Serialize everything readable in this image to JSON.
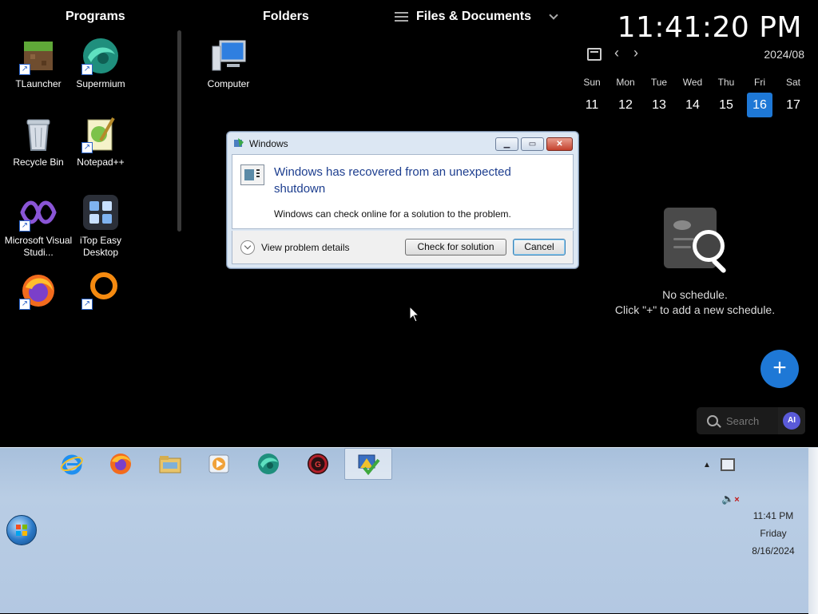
{
  "headers": {
    "programs": "Programs",
    "folders": "Folders",
    "files": "Files & Documents"
  },
  "programs": [
    {
      "label": "TLauncher",
      "icon": "tlauncher-icon"
    },
    {
      "label": "Supermium",
      "icon": "supermium-icon"
    },
    {
      "label": "Recycle Bin",
      "icon": "recycle-bin-icon"
    },
    {
      "label": "Notepad++",
      "icon": "notepad-plus-plus-icon"
    },
    {
      "label": "Microsoft Visual Studi...",
      "icon": "visual-studio-icon"
    },
    {
      "label": "iTop Easy Desktop",
      "icon": "itop-easy-desktop-icon"
    },
    {
      "label": "",
      "icon": "firefox-icon"
    },
    {
      "label": "",
      "icon": "orange-ring-app-icon"
    }
  ],
  "folders": [
    {
      "label": "Computer",
      "icon": "computer-icon"
    }
  ],
  "clock": "11:41:20 PM",
  "calendar": {
    "month": "2024/08",
    "weekdays": [
      "Sun",
      "Mon",
      "Tue",
      "Wed",
      "Thu",
      "Fri",
      "Sat"
    ],
    "days": [
      "11",
      "12",
      "13",
      "14",
      "15",
      "16",
      "17"
    ],
    "today_index": 5,
    "accent_color": "#1e78d6"
  },
  "schedule": {
    "empty_title": "No schedule.",
    "empty_hint": "Click \"+\" to add a new schedule."
  },
  "add_button": "+",
  "search": {
    "placeholder": "Search",
    "ai_label": "AI"
  },
  "dialog": {
    "title": "Windows",
    "heading": "Windows has recovered from an unexpected shutdown",
    "message": "Windows can check online for a solution to the problem.",
    "details_label": "View problem details",
    "check_button": "Check for solution",
    "cancel_button": "Cancel"
  },
  "taskbar": {
    "items": [
      {
        "icon": "internet-explorer-icon",
        "color": "#1f8ff0"
      },
      {
        "icon": "firefox-icon",
        "color": "#f26b1d"
      },
      {
        "icon": "file-explorer-icon",
        "color": "#e8c46a"
      },
      {
        "icon": "media-player-icon",
        "color": "#f0a23a"
      },
      {
        "icon": "supermium-icon",
        "color": "#2aa88a"
      },
      {
        "icon": "game-app-icon",
        "color": "#b3202a"
      },
      {
        "icon": "action-center-icon",
        "color": "#3a6fc2",
        "active": true
      }
    ],
    "time": "11:41 PM",
    "day": "Friday",
    "date": "8/16/2024"
  }
}
